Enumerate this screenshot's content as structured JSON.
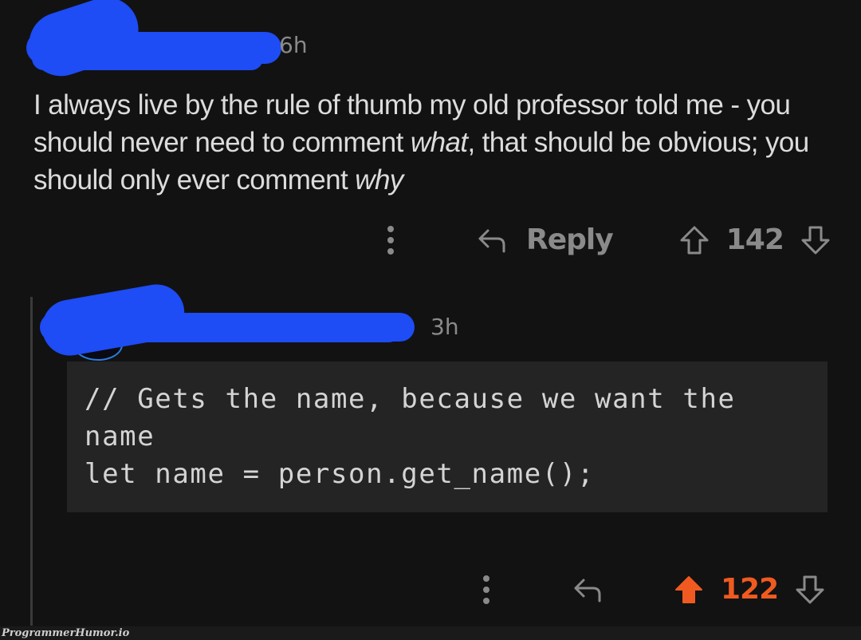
{
  "parent_comment": {
    "username": "[redacted]",
    "timestamp": "6h",
    "text_segments": [
      {
        "text": "I always live by the rule of thumb my old professor told me - you should never need to comment ",
        "italic": false
      },
      {
        "text": "what",
        "italic": true
      },
      {
        "text": ", that should be obvious; you should only ever comment ",
        "italic": false
      },
      {
        "text": "why",
        "italic": true
      }
    ],
    "actions": {
      "more_icon": "kebab-vertical-icon",
      "reply_icon": "reply-arrow-icon",
      "reply_label": "Reply",
      "upvote_icon": "upvote-outline-icon",
      "score": "142",
      "downvote_icon": "downvote-outline-icon",
      "vote_state": "none"
    }
  },
  "child_comment": {
    "username": "[redacted]",
    "timestamp": "3h",
    "code_lines": [
      "// Gets the name, because we want the name",
      "let name = person.get_name();"
    ],
    "actions": {
      "more_icon": "kebab-vertical-icon",
      "reply_icon": "reply-arrow-icon",
      "upvote_icon": "upvote-filled-icon",
      "score": "122",
      "downvote_icon": "downvote-outline-icon",
      "vote_state": "upvoted"
    }
  },
  "colors": {
    "background": "#121212",
    "redaction": "#1e4cf5",
    "upvote": "#f05a20",
    "muted": "#8a8a8a",
    "code_bg": "#242424"
  },
  "watermark": "ProgrammerHumor.io"
}
